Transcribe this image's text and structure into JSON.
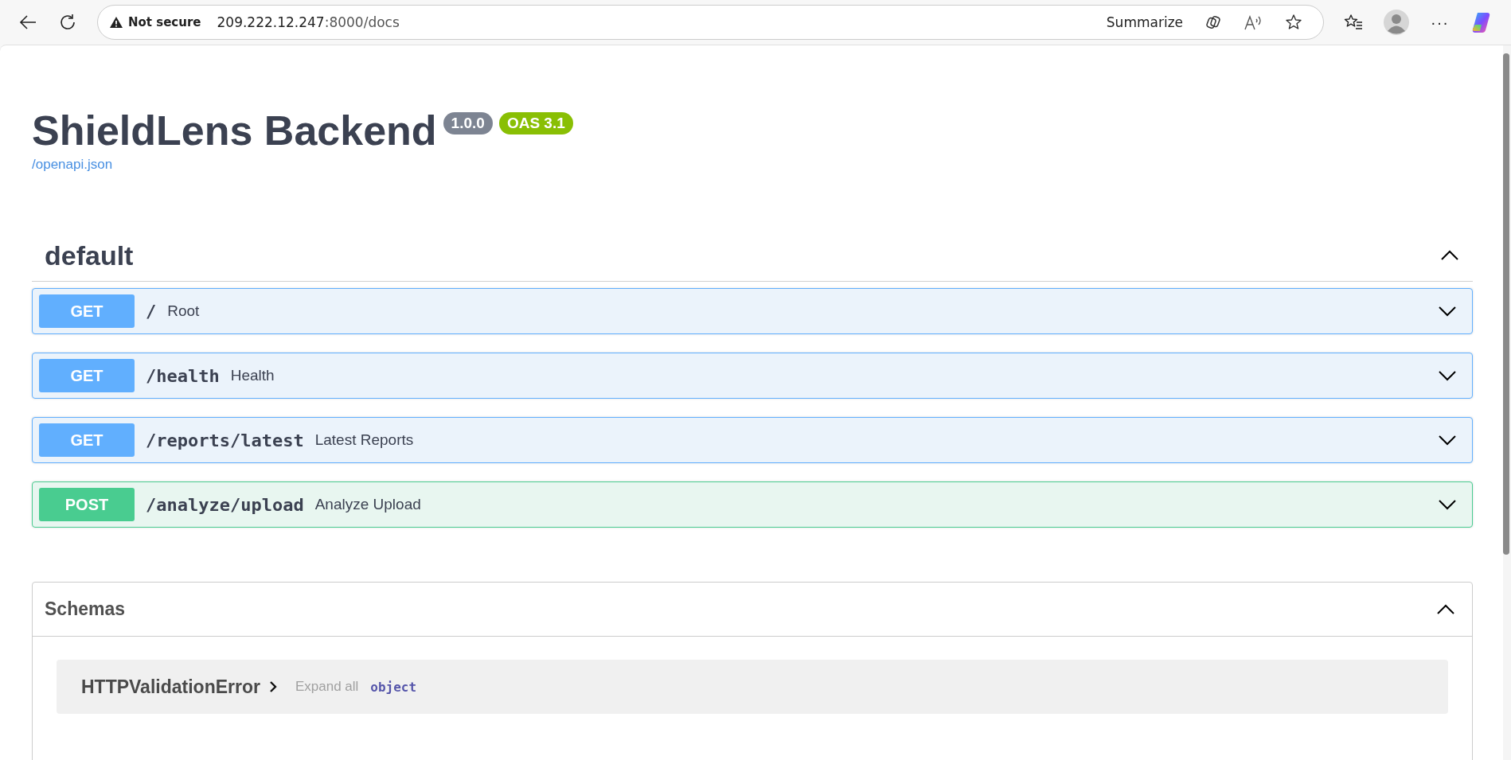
{
  "browser": {
    "security": "Not secure",
    "url_host": "209.222.12.247",
    "url_rest": ":8000/docs",
    "summarize": "Summarize",
    "more": "···"
  },
  "info": {
    "title": "ShieldLens Backend",
    "version": "1.0.0",
    "oas": "OAS 3.1",
    "spec_link": "/openapi.json"
  },
  "tag": {
    "name": "default",
    "expanded": true,
    "operations": [
      {
        "method": "GET",
        "kind": "get",
        "path": "/",
        "summary": "Root",
        "expanded": false
      },
      {
        "method": "GET",
        "kind": "get",
        "path": "/health",
        "summary": "Health",
        "expanded": false
      },
      {
        "method": "GET",
        "kind": "get",
        "path": "/reports/latest",
        "summary": "Latest Reports",
        "expanded": false
      },
      {
        "method": "POST",
        "kind": "post",
        "path": "/analyze/upload",
        "summary": "Analyze Upload",
        "expanded": false
      }
    ]
  },
  "schemas": {
    "title": "Schemas",
    "expanded": true,
    "items": [
      {
        "name": "HTTPValidationError",
        "expand_all": "Expand all",
        "type": "object",
        "expanded": false
      }
    ]
  }
}
